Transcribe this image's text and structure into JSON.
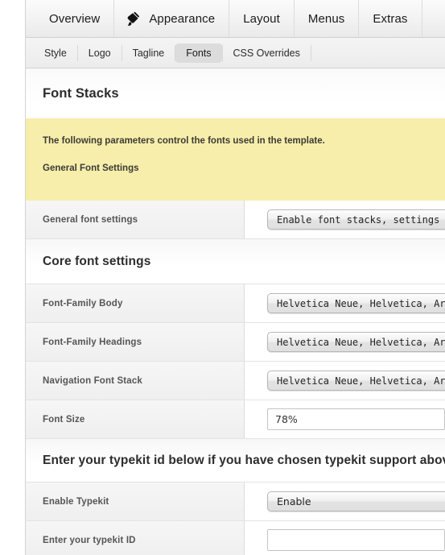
{
  "main_nav": {
    "items": [
      {
        "label": "Overview",
        "icon": null,
        "active": false
      },
      {
        "label": "Appearance",
        "icon": "paintbrush-icon",
        "active": true
      },
      {
        "label": "Layout",
        "icon": null,
        "active": false
      },
      {
        "label": "Menus",
        "icon": null,
        "active": false
      },
      {
        "label": "Extras",
        "icon": null,
        "active": false
      }
    ]
  },
  "sub_nav": {
    "items": [
      {
        "label": "Style",
        "active": false
      },
      {
        "label": "Logo",
        "active": false
      },
      {
        "label": "Tagline",
        "active": false
      },
      {
        "label": "Fonts",
        "active": true
      },
      {
        "label": "CSS Overrides",
        "active": false
      }
    ]
  },
  "panel": {
    "title": "Font Stacks",
    "notice": {
      "line1": "The following parameters control the fonts used in the template.",
      "line2": "General Font Settings",
      "background": "#f7eeac"
    },
    "rows": [
      {
        "label": "General font settings",
        "control": "select",
        "value": "Enable font stacks, settings and typekit"
      }
    ],
    "core_section": {
      "title": "Core font settings",
      "rows": [
        {
          "label": "Font-Family Body",
          "control": "select",
          "value": "Helvetica Neue, Helvetica, Arial, sans-serif"
        },
        {
          "label": "Font-Family Headings",
          "control": "select",
          "value": "Helvetica Neue, Helvetica, Arial, sans-serif"
        },
        {
          "label": "Navigation Font Stack",
          "control": "select",
          "value": "Helvetica Neue, Helvetica, Arial, sans-serif"
        },
        {
          "label": "Font Size",
          "control": "text",
          "value": "78%"
        }
      ]
    },
    "typekit_section": {
      "title": "Enter your typekit id below if you have chosen typekit support above",
      "rows": [
        {
          "label": "Enable Typekit",
          "control": "select",
          "value": "Enable"
        },
        {
          "label": "Enter your typekit ID",
          "control": "text",
          "value": ""
        }
      ]
    }
  }
}
